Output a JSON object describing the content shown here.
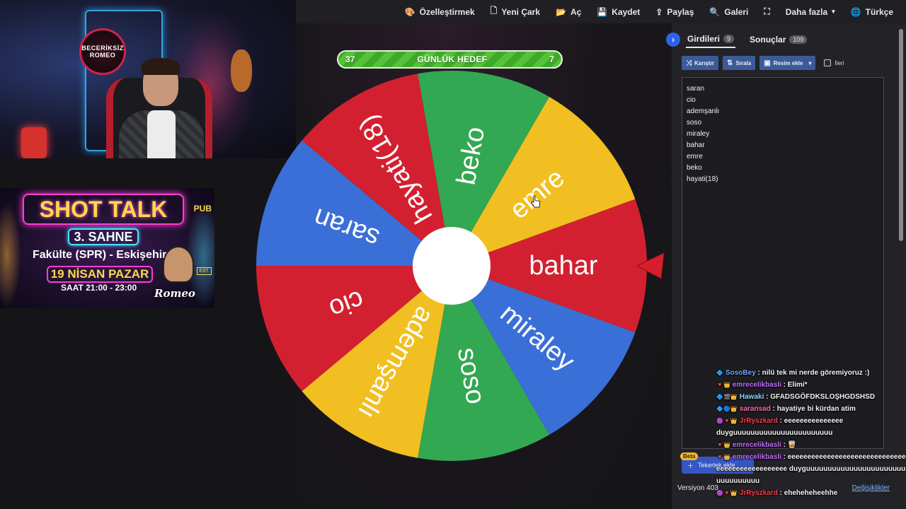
{
  "nav": {
    "items": [
      {
        "icon": "palette-icon",
        "glyph": "🎨",
        "label": "Özelleştirmek"
      },
      {
        "icon": "file-icon",
        "glyph": "🗋",
        "label": "Yeni Çark"
      },
      {
        "icon": "folder-open-icon",
        "glyph": "📂",
        "label": "Aç"
      },
      {
        "icon": "save-icon",
        "glyph": "💾",
        "label": "Kaydet"
      },
      {
        "icon": "share-icon",
        "glyph": "⇪",
        "label": "Paylaş"
      },
      {
        "icon": "search-icon",
        "glyph": "🔍",
        "label": "Galeri"
      },
      {
        "icon": "fullscreen-icon",
        "glyph": "⛶",
        "label": ""
      },
      {
        "icon": "chevron-down-icon",
        "glyph": "▾",
        "label": "Daha fazla"
      },
      {
        "icon": "globe-icon",
        "glyph": "🌐",
        "label": "Türkçe"
      }
    ]
  },
  "overlay": {
    "webcam_logo_top": "BECERİKSİZ",
    "webcam_logo_bottom": "ROMEO",
    "poster": {
      "title": "SHOT TALK",
      "stage": "3. SAHNE",
      "venue": "Fakülte (SPR) - Eskişehir",
      "date": "19 NİSAN PAZAR",
      "time": "SAAT 21:00 - 23:00",
      "pub": "PUB",
      "est": "EST.",
      "signature": "Romeo"
    }
  },
  "goal": {
    "left_value": "37",
    "label": "GÜNLÜK HEDEF",
    "right_value": "7"
  },
  "wheel": {
    "segments": [
      {
        "label": "bahar",
        "color": "#d32030"
      },
      {
        "label": "miraley",
        "color": "#3a6fd8"
      },
      {
        "label": "soso",
        "color": "#32a852"
      },
      {
        "label": "ademşanlı",
        "color": "#f1bf21"
      },
      {
        "label": "cio",
        "color": "#d32030"
      },
      {
        "label": "saran",
        "color": "#3a6fd8"
      },
      {
        "label": "hayati(18)",
        "color": "#d32030"
      },
      {
        "label": "beko",
        "color": "#32a852"
      },
      {
        "label": "emre",
        "color": "#f1bf21"
      }
    ],
    "pointer_color": "#d81e2c",
    "center_color": "#ffffff"
  },
  "panel": {
    "tab_entries": {
      "label": "Girdileri",
      "count": "9"
    },
    "tab_results": {
      "label": "Sonuçlar",
      "count": "109"
    },
    "shuffle_label": "Karıştır",
    "sort_label": "Sırala",
    "image_label": "Resim ekle",
    "advanced_label": "İleri",
    "entries": [
      "saran",
      "cio",
      "ademşanlı",
      "soso",
      "miraley",
      "bahar",
      "emre",
      "beko",
      "hayati(18)"
    ],
    "add_wheel_label": "Tekerlek ekle",
    "beta_label": "Beta",
    "version_label": "Versiyon 403",
    "changes_label": "Değişiklikler"
  },
  "chat": [
    {
      "user": "SosoBey",
      "color": "blue",
      "text": ": nilü tek mi nerde göremiyoruz :)"
    },
    {
      "user": "emrecelikbasli",
      "color": "violet",
      "text": ": Elimi*"
    },
    {
      "user": "Hawaki",
      "color": "cyan",
      "text": ": GFADSGÖFDKSLOŞHGDSHSD"
    },
    {
      "user": "saransad",
      "color": "pink",
      "text": ": hayatiye bi kürdan atim"
    },
    {
      "user": "JrRyszkard",
      "color": "red",
      "text": ": eeeeeeeeeeeeeee duyguuuuuuuuuuuuuuuuuuuuuuu"
    },
    {
      "user": "emrecelikbasli",
      "color": "violet",
      "text": ": 🥃"
    },
    {
      "user": "emrecelikbasli",
      "color": "violet",
      "text": ": eeeeeeeeeeeeeeeeeeeeeeeeeeeeeeeeeeeeeeeeeeeeeeee duyguuuuuuuuuuuuuuuuuuuuuuuuuuuuuuuuu"
    },
    {
      "user": "JrRyszkard",
      "color": "red",
      "text": ": eheheheheehhe"
    }
  ]
}
